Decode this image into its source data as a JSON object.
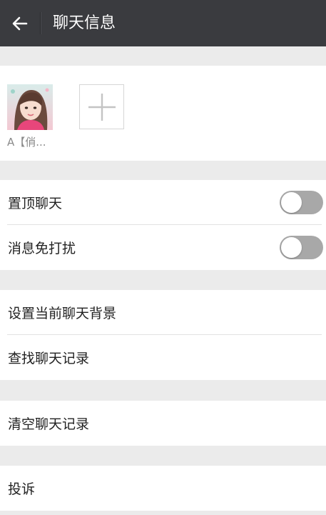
{
  "header": {
    "title": "聊天信息"
  },
  "members": {
    "items": [
      {
        "name": "A【俏...",
        "avatar": "avatar"
      }
    ],
    "add_icon": "plus-icon"
  },
  "settings": {
    "pin_chat": {
      "label": "置顶聊天",
      "enabled": false
    },
    "mute": {
      "label": "消息免打扰",
      "enabled": false
    },
    "set_background": {
      "label": "设置当前聊天背景"
    },
    "search_history": {
      "label": "查找聊天记录"
    },
    "clear_history": {
      "label": "清空聊天记录"
    },
    "report": {
      "label": "投诉"
    }
  },
  "colors": {
    "header_bg": "#3a3b3f",
    "page_bg": "#ebebeb",
    "toggle_off": "#a8a8a8"
  }
}
